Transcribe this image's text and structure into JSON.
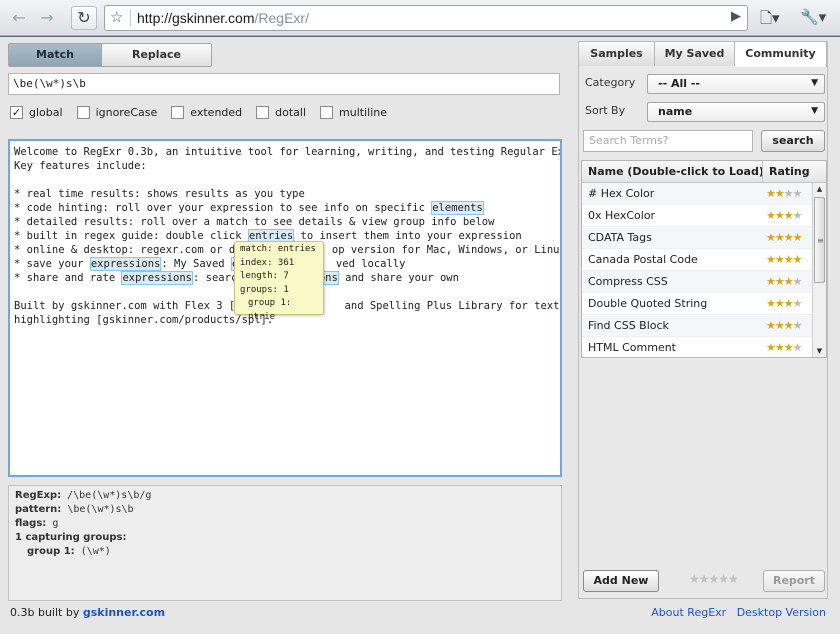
{
  "browser": {
    "url_host": "http://gskinner.com",
    "url_path": "/RegExr/",
    "back_icon": "arrow-left-icon",
    "forward_icon": "arrow-right-icon"
  },
  "tabs": {
    "match": "Match",
    "replace": "Replace"
  },
  "expression": "\\be(\\w*)s\\b",
  "flags": [
    {
      "label": "global",
      "checked": true
    },
    {
      "label": "ignoreCase",
      "checked": false
    },
    {
      "label": "extended",
      "checked": false
    },
    {
      "label": "dotall",
      "checked": false
    },
    {
      "label": "multiline",
      "checked": false
    }
  ],
  "source_text": {
    "l1": "Welcome to RegExr 0.3b, an intuitive tool for learning, writing, and testing Regular Expressions.",
    "l2": "Key features include:",
    "l3": "* real time results: shows results as you type",
    "l4a": "* code hinting: roll over your expression to see info on specific ",
    "l4m": "elements",
    "l5a": "* detailed results: roll over a match to see details & view group info below",
    "l6a": "* built in regex guide: double click ",
    "l6m": "entries",
    "l6b": " to insert them into your expression",
    "l7a": "* online & desktop: regexr.com or dow",
    "l7b": "op version for Mac, Windows, or Linux",
    "l8a": "* save your ",
    "l8m": "expressions",
    "l8b": ": My Saved ",
    "l8m2": "exp",
    "l8c": "ved locally",
    "l9a": "* share and rate ",
    "l9m": "expressions",
    "l9b": ": search C",
    "l9m2": "ressions",
    "l9c": " and share your own",
    "l11a": "Built by gskinner.com with Flex 3 [adob",
    "l11b": "and Spelling Plus Library for text",
    "l12": "highlighting [gskinner.com/products/spl]."
  },
  "tooltip": {
    "match": "match: entries",
    "index": "index: 361",
    "length": "length: 7",
    "groups": "groups: 1",
    "group1": "group 1: ntrie"
  },
  "details": {
    "regexp_label": "RegExp:",
    "regexp_value": "/\\be(\\w*)s\\b/g",
    "pattern_label": "pattern:",
    "pattern_value": "\\be(\\w*)s\\b",
    "flags_label": "flags:",
    "flags_value": "g",
    "groups_heading": "1 capturing groups:",
    "group1_label": "group 1:",
    "group1_value": "(\\w*)"
  },
  "footer": {
    "version_text": "0.3b built by",
    "brand": "gskinner.com",
    "about": "About RegExr",
    "desktop": "Desktop Version"
  },
  "right_panel": {
    "tabs": [
      "Samples",
      "My Saved",
      "Community"
    ],
    "category_label": "Category",
    "category_value": "-- All --",
    "sortby_label": "Sort By",
    "sortby_value": "name",
    "search_placeholder": "Search Terms?",
    "search_button": "search",
    "col_name": "Name (Double-click to Load)",
    "col_rating": "Rating",
    "items": [
      {
        "name": "# Hex Color",
        "rating": 2
      },
      {
        "name": "0x HexColor",
        "rating": 3
      },
      {
        "name": "CDATA Tags",
        "rating": 4
      },
      {
        "name": "Canada Postal Code",
        "rating": 4
      },
      {
        "name": "Compress CSS",
        "rating": 3
      },
      {
        "name": "Double Quoted String",
        "rating": 3
      },
      {
        "name": "Find CSS Block",
        "rating": 3
      },
      {
        "name": "HTML Comment",
        "rating": 3
      }
    ],
    "add_new": "Add New",
    "report": "Report"
  }
}
